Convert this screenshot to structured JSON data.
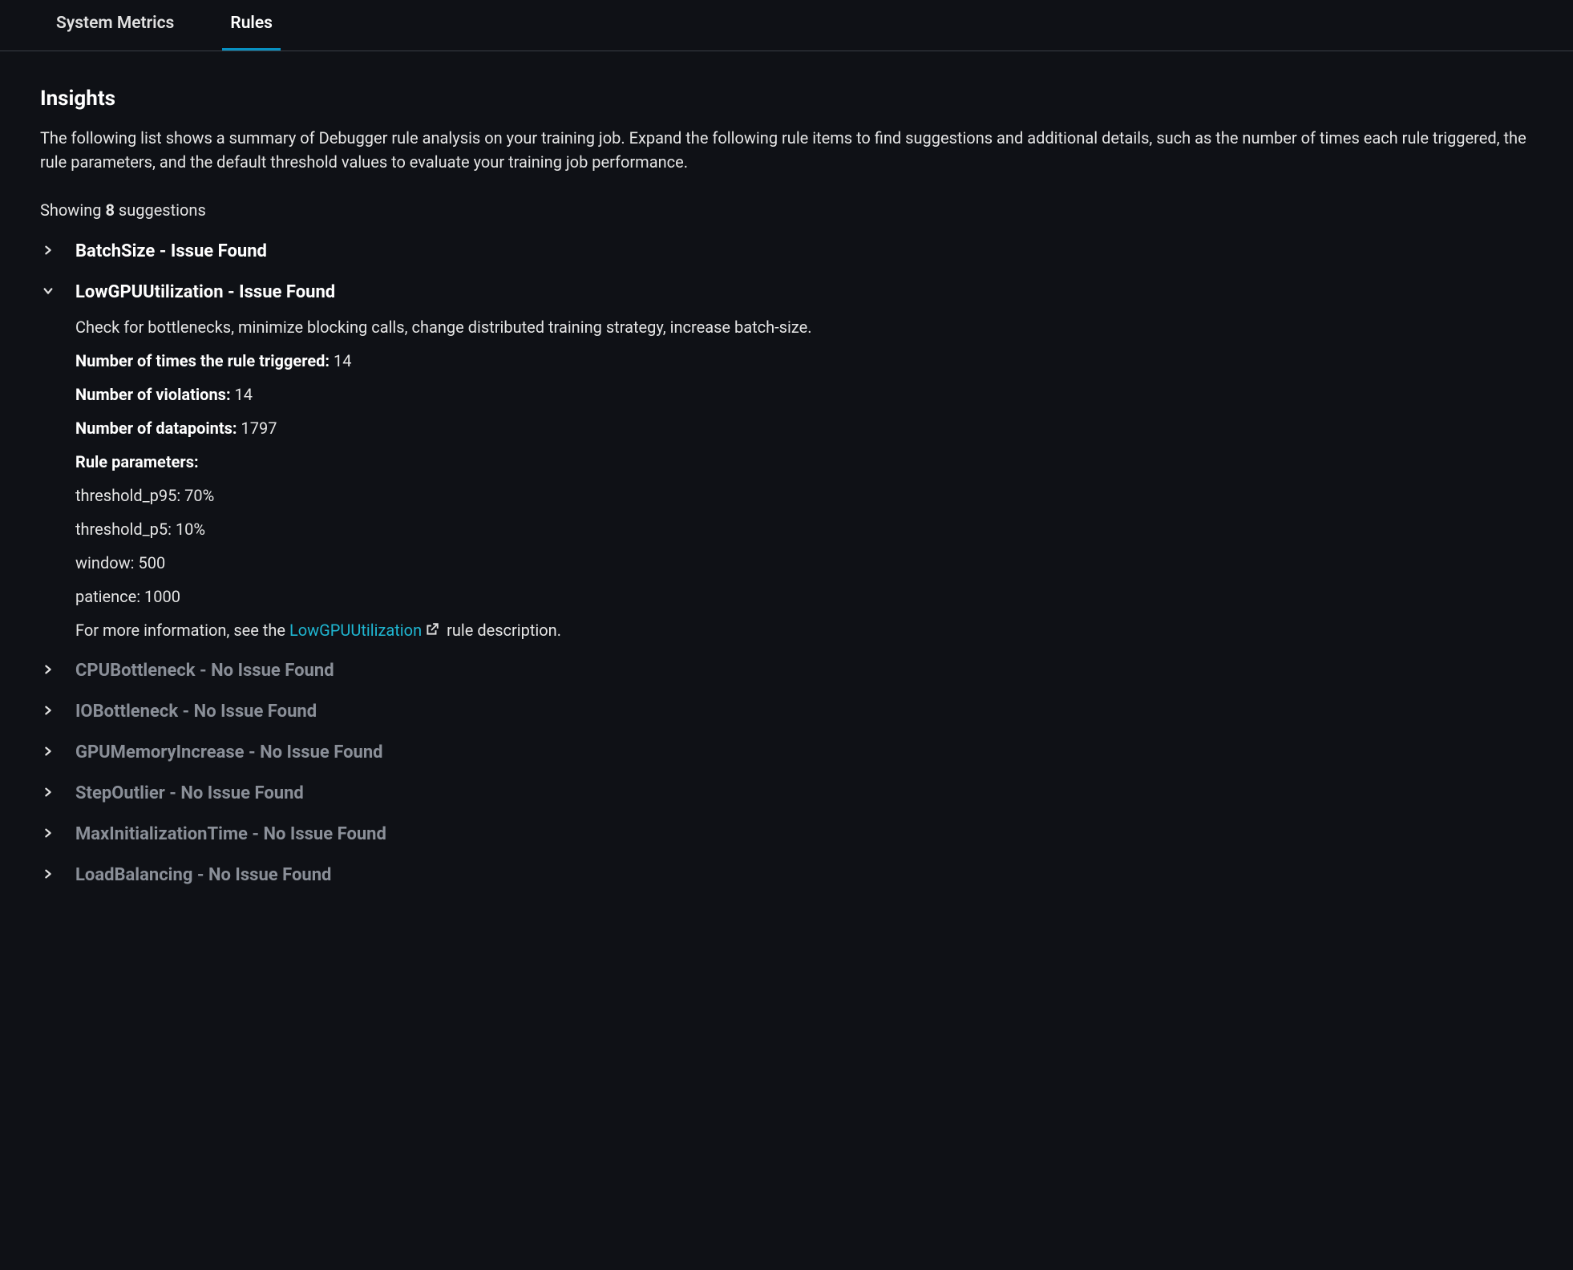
{
  "tabs": {
    "system_metrics": "System Metrics",
    "rules": "Rules"
  },
  "insights": {
    "title": "Insights",
    "description": "The following list shows a summary of Debugger rule analysis on your training job. Expand the following rule items to find suggestions and additional details, such as the number of times each rule triggered, the rule parameters, and the default threshold values to evaluate your training job performance.",
    "showing_prefix": "Showing ",
    "showing_count": "8",
    "showing_suffix": " suggestions"
  },
  "rules": [
    {
      "title": "BatchSize - Issue Found",
      "expanded": false,
      "issue": true
    },
    {
      "title": "LowGPUUtilization - Issue Found",
      "expanded": true,
      "issue": true,
      "suggestion": "Check for bottlenecks, minimize blocking calls, change distributed training strategy, increase batch-size.",
      "triggered_label": "Number of times the rule triggered: ",
      "triggered_value": "14",
      "violations_label": "Number of violations: ",
      "violations_value": "14",
      "datapoints_label": "Number of datapoints: ",
      "datapoints_value": "1797",
      "params_label": "Rule parameters:",
      "params": [
        "threshold_p95: 70%",
        "threshold_p5: 10%",
        "window: 500",
        "patience: 1000"
      ],
      "more_info_prefix": "For more information, see the ",
      "more_info_link": "LowGPUUtilization",
      "more_info_suffix": " rule description."
    },
    {
      "title": "CPUBottleneck - No Issue Found",
      "expanded": false,
      "issue": false
    },
    {
      "title": "IOBottleneck - No Issue Found",
      "expanded": false,
      "issue": false
    },
    {
      "title": "GPUMemoryIncrease - No Issue Found",
      "expanded": false,
      "issue": false
    },
    {
      "title": "StepOutlier - No Issue Found",
      "expanded": false,
      "issue": false
    },
    {
      "title": "MaxInitializationTime - No Issue Found",
      "expanded": false,
      "issue": false
    },
    {
      "title": "LoadBalancing - No Issue Found",
      "expanded": false,
      "issue": false
    }
  ]
}
